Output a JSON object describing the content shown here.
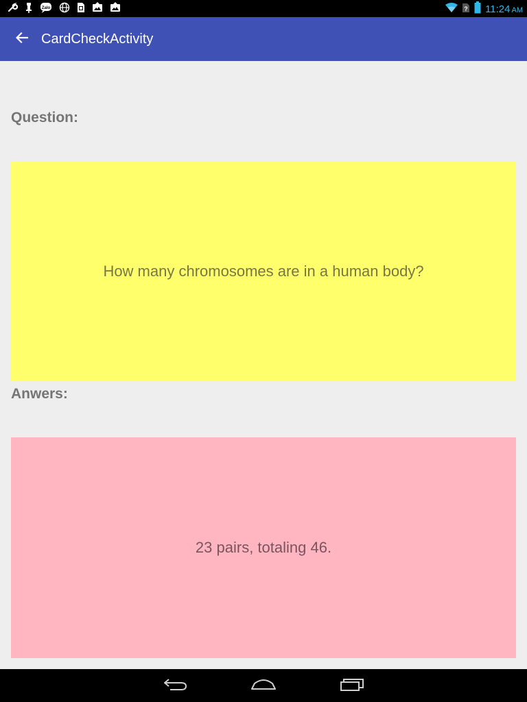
{
  "status_bar": {
    "time": "11:24",
    "ampm": "AM",
    "icons": [
      "wrench-icon",
      "pin-icon",
      "zalo-icon",
      "globe-icon",
      "sim-icon",
      "image-upload-icon",
      "image-upload-icon-2"
    ],
    "right_icons": [
      "wifi-icon",
      "signal-icon",
      "battery-icon"
    ]
  },
  "app_bar": {
    "title": "CardCheckActivity",
    "back_icon": "arrow-left-icon",
    "color": "#3f51b5"
  },
  "question": {
    "label": "Question:",
    "text": "How many chromosomes are in a human body?",
    "card_color": "#ffff6b"
  },
  "answer": {
    "label": "Anwers:",
    "text": "23 pairs, totaling 46.",
    "card_color": "#ffb6c1"
  },
  "nav_bar": {
    "buttons": [
      "back-icon",
      "home-icon",
      "recents-icon"
    ]
  }
}
